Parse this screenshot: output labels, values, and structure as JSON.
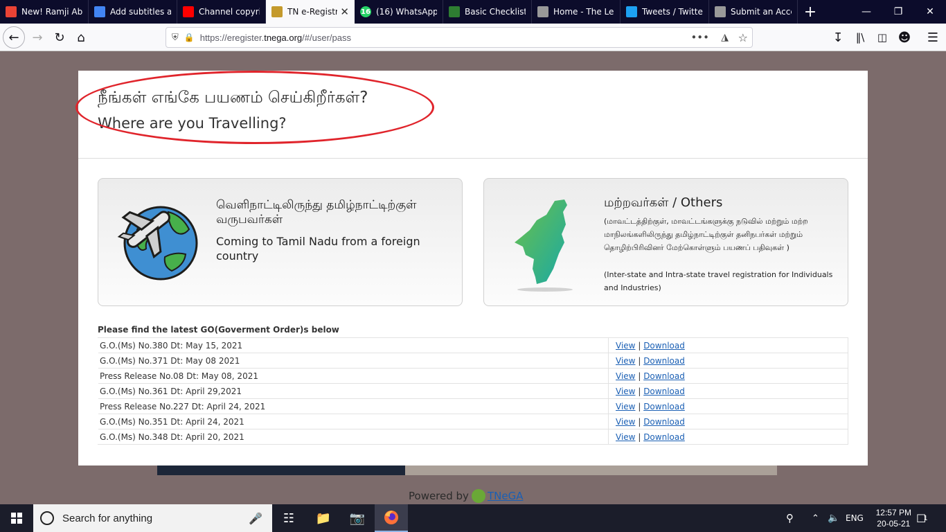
{
  "browser": {
    "tabs": [
      {
        "title": "New! Ramji Abil",
        "icon": "gmail-icon",
        "color": "#ea4335"
      },
      {
        "title": "Add subtitles an",
        "icon": "google-icon",
        "color": "#4285f4"
      },
      {
        "title": "Channel copyrig",
        "icon": "youtube-icon",
        "color": "#ff0000"
      },
      {
        "title": "TN e-Registra",
        "icon": "tn-emblem-icon",
        "color": "#c49a2c"
      },
      {
        "title": "(16) WhatsApp",
        "icon": "whatsapp-icon",
        "color": "#25d366",
        "badge": "16"
      },
      {
        "title": "Basic Checklist:",
        "icon": "leaf-icon",
        "color": "#2e7d32"
      },
      {
        "title": "Home - The Lea",
        "icon": "page-icon",
        "color": "#999999"
      },
      {
        "title": "Tweets / Twitter",
        "icon": "twitter-icon",
        "color": "#1da1f2"
      },
      {
        "title": "Submit an Acces",
        "icon": "page-icon",
        "color": "#999999"
      }
    ],
    "url_prefix": "https://eregister.",
    "url_domain": "tnega.org",
    "url_path": "/#/user/pass"
  },
  "page": {
    "title_ta": "நீங்கள் எங்கே பயணம் செய்கிறீர்கள்?",
    "title_en": "Where are you Travelling?",
    "options": {
      "foreign": {
        "title_ta": "வெளிநாட்டிலிருந்து தமிழ்நாட்டிற்குள் வருபவர்கள்",
        "title_en": "Coming to Tamil Nadu from a foreign country"
      },
      "others": {
        "title": "மற்றவர்கள் / Others",
        "desc_ta": "(மாவட்டத்திற்குள், மாவட்டங்களுக்கு நடுவில் மற்றும் மற்ற மாநிலங்களிலிருந்து தமிழ்நாட்டிற்குள் தனிநபர்கள் மற்றும் தொழிற்பிரிவினர் மேற்கொள்ளும் பயணப் பதிவுகள் )",
        "desc_en": "(Inter-state and Intra-state travel registration for Individuals and Industries)"
      }
    },
    "go_heading": "Please find the latest GO(Goverment Order)s below",
    "view_label": "View",
    "separator": "|",
    "download_label": "Download",
    "go_rows": [
      "G.O.(Ms) No.380 Dt: May 15, 2021",
      "G.O.(Ms) No.371 Dt: May 08 2021",
      "Press Release No.08 Dt: May 08, 2021",
      "G.O.(Ms) No.361 Dt: April 29,2021",
      "Press Release No.227 Dt: April 24, 2021",
      "G.O.(Ms) No.351 Dt: April 24, 2021",
      "G.O.(Ms) No.348 Dt: April 20, 2021"
    ],
    "powered_by": "Powered by",
    "powered_link": "TNeGA"
  },
  "taskbar": {
    "search_placeholder": "Search for anything",
    "language": "ENG",
    "time": "12:57 PM",
    "date": "20-05-21",
    "notification_count": "1"
  }
}
